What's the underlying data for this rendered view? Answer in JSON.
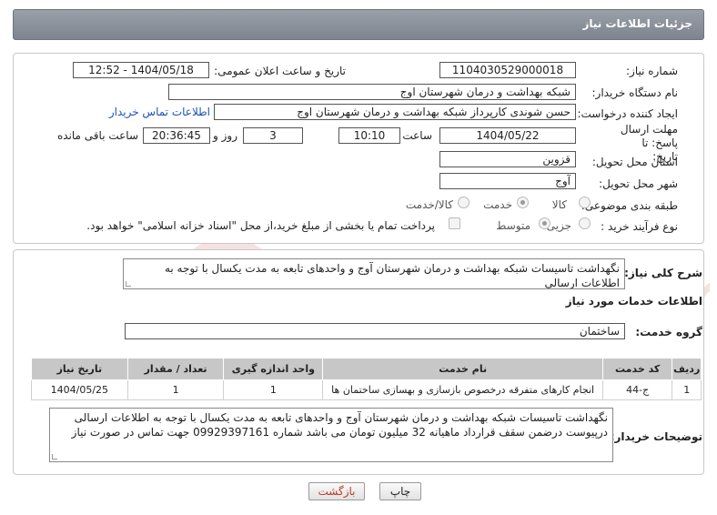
{
  "header": {
    "title": "جزئیات اطلاعات نیاز"
  },
  "form": {
    "need_number_label": "شماره نیاز:",
    "need_number": "1104030529000018",
    "announce_label": "تاریخ و ساعت اعلان عمومی:",
    "announce_value": "1404/05/18 - 12:52",
    "buyer_org_label": "نام دستگاه خریدار:",
    "buyer_org": "شبکه بهداشت و درمان شهرستان اوج",
    "requester_label": "ایجاد کننده درخواست:",
    "requester": "حسن شوندی کارپرداز شبکه بهداشت و درمان شهرستان اوج",
    "buyer_contact_link": "اطلاعات تماس خریدار",
    "deadline_label": "مهلت ارسال پاسخ: تا تاریخ:",
    "deadline_date": "1404/05/22",
    "time_label": "ساعت",
    "deadline_time": "10:10",
    "days_value": "3",
    "days_label": "روز و",
    "remaining_time": "20:36:45",
    "remaining_label": "ساعت باقی مانده",
    "province_label": "استان محل تحویل:",
    "province": "قزوین",
    "city_label": "شهر محل تحویل:",
    "city": "آوج",
    "category_label": "طبقه بندی موضوعی:",
    "category_options": [
      "کالا",
      "خدمت",
      "کالا/خدمت"
    ],
    "category_selected": "خدمت",
    "process_label": "نوع فرآیند خرید :",
    "process_options": [
      "جزیی",
      "متوسط"
    ],
    "process_selected": "متوسط",
    "treasury_note": "پرداخت تمام یا بخشی از مبلغ خرید،از محل \"اسناد خزانه اسلامی\" خواهد بود."
  },
  "description": {
    "label": "شرح کلی نیاز:",
    "text": "نگهداشت تاسیسات شبکه بهداشت و درمان شهرستان آوج و واحدهای تابعه به مدت یکسال با توجه به اطلاعات ارسالی"
  },
  "services": {
    "section_title": "اطلاعات خدمات مورد نیاز",
    "group_label": "گروه خدمت:",
    "group_value": "ساختمان",
    "columns": [
      "ردیف",
      "کد خدمت",
      "نام خدمت",
      "واحد اندازه گیری",
      "تعداد / مقدار",
      "تاریخ نیاز"
    ],
    "rows": [
      [
        "1",
        "ج-44",
        "انجام کارهای متفرقه درخصوص بازسازی و بهسازی ساختمان ها",
        "1",
        "1",
        "1404/05/25"
      ]
    ]
  },
  "buyer_notes": {
    "label": "توضیحات خریدار:",
    "text": "نگهداشت تاسیسات شبکه بهداشت و درمان شهرستان آوج و واحدهای تابعه به مدت یکسال با توجه به اطلاعات ارسالی درپیوست درضمن سقف قرارداد ماهیانه 32 میلیون تومان می باشد شماره 09929397161 جهت تماس در صورت نیاز"
  },
  "buttons": {
    "print": "چاپ",
    "back": "بازگشت"
  },
  "watermark": {
    "text": "AriaTender.neT"
  },
  "colors": {
    "header": "#8a9099",
    "link": "#1a52b8",
    "back_button_text": "#c0392b"
  }
}
